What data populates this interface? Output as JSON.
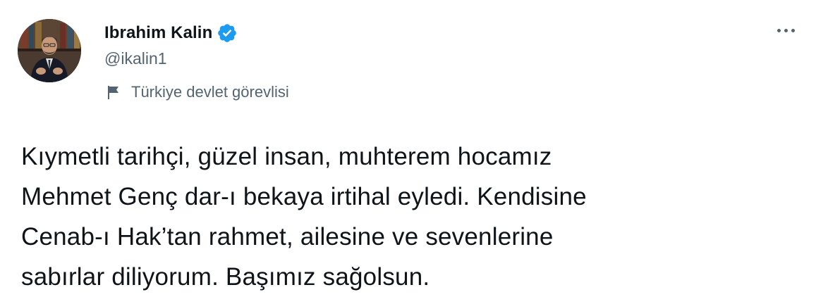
{
  "author": {
    "display_name": "Ibrahim Kalin",
    "handle": "@ikalin1",
    "verified": true,
    "account_label": "Türkiye devlet görevlisi"
  },
  "tweet": {
    "text": "Kıymetli tarihçi, güzel insan, muhterem hocamız\nMehmet Genç dar-ı bekaya irtihal eyledi. Kendisine\nCenab-ı Hak’tan rahmet, ailesine ve sevenlerine\nsabırlar diliyorum. Başımız sağolsun."
  },
  "icons": {
    "verified": "verified-badge-icon",
    "label": "flag-icon",
    "more": "more-options-icon"
  },
  "colors": {
    "verified_blue": "#1d9bf0",
    "secondary_text": "#536471",
    "primary_text": "#0f1419"
  }
}
